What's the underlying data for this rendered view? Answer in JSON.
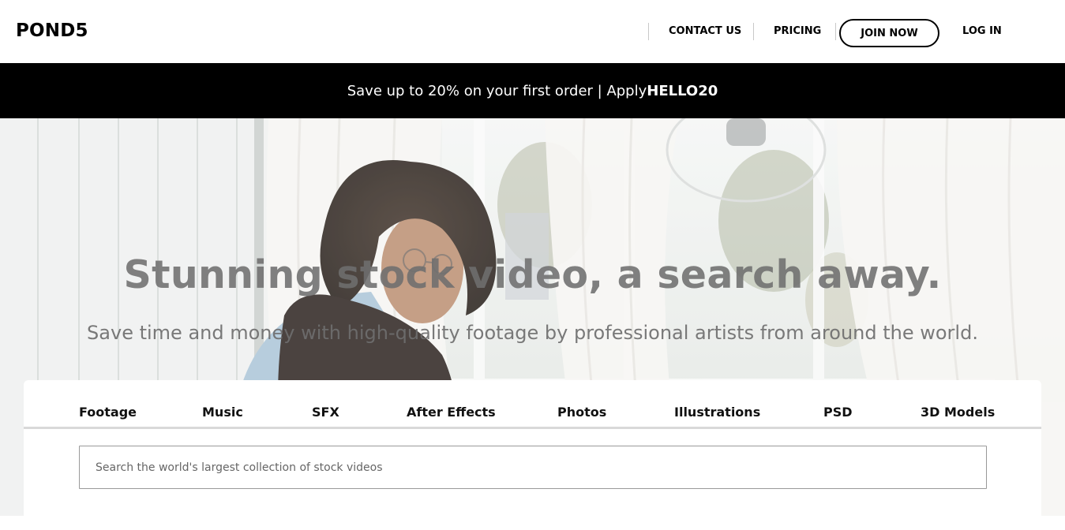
{
  "header": {
    "logo": "POND5",
    "nav": {
      "contact": "CONTACT US",
      "pricing": "PRICING",
      "join": "JOIN NOW",
      "login": "LOG IN"
    }
  },
  "promo": {
    "text": "Save up to 20% on your first order | Apply ",
    "code": "HELLO20"
  },
  "hero": {
    "title": "Stunning stock video, a search away.",
    "subtitle": "Save time and money with high-quality footage by professional artists from around the world."
  },
  "search": {
    "tabs": [
      "Footage",
      "Music",
      "SFX",
      "After Effects",
      "Photos",
      "Illustrations",
      "PSD",
      "3D Models"
    ],
    "placeholder": "Search the world's largest collection of stock videos"
  },
  "colors": {
    "banner_bg": "#000000",
    "banner_text": "#ffffff",
    "hero_text": "#6e6e6e"
  }
}
